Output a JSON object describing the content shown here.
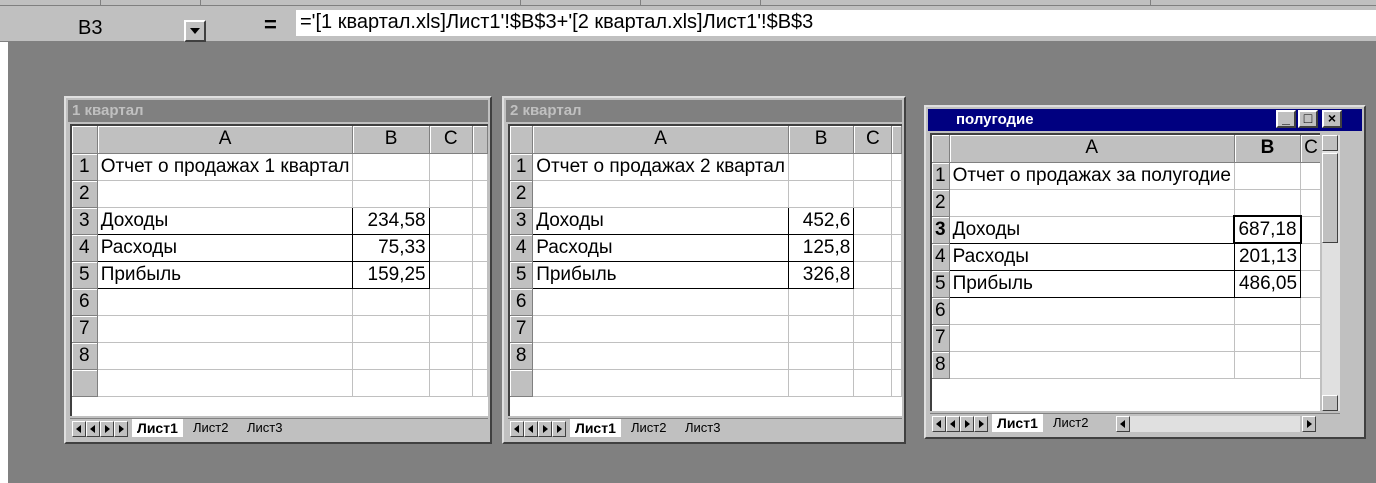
{
  "formula_bar": {
    "name_box": "B3",
    "equals_label": "=",
    "formula": "='[1 квартал.xls]Лист1'!$B$3+'[2 квартал.xls]Лист1'!$B$3"
  },
  "columns": [
    "A",
    "B",
    "C"
  ],
  "rows": [
    "1",
    "2",
    "3",
    "4",
    "5",
    "6",
    "7",
    "8"
  ],
  "sheet_tabs": [
    "Лист1",
    "Лист2",
    "Лист3"
  ],
  "windows": {
    "q1": {
      "title": "1 квартал",
      "heading": "Отчет о продажах 1 квартал",
      "labels": [
        "Доходы",
        "Расходы",
        "Прибыль"
      ],
      "values": [
        "234,58",
        "75,33",
        "159,25"
      ]
    },
    "q2": {
      "title": "2 квартал",
      "heading": "Отчет о продажах 2 квартал",
      "labels": [
        "Доходы",
        "Расходы",
        "Прибыль"
      ],
      "values": [
        "452,6",
        "125,8",
        "326,8"
      ]
    },
    "half": {
      "title": "полугодие",
      "heading": "Отчет о продажах  за полугодие",
      "labels": [
        "Доходы",
        "Расходы",
        "Прибыль"
      ],
      "values": [
        "687,18",
        "201,13",
        "486,05"
      ],
      "minimize": "_",
      "maximize": "□",
      "close": "×"
    }
  }
}
